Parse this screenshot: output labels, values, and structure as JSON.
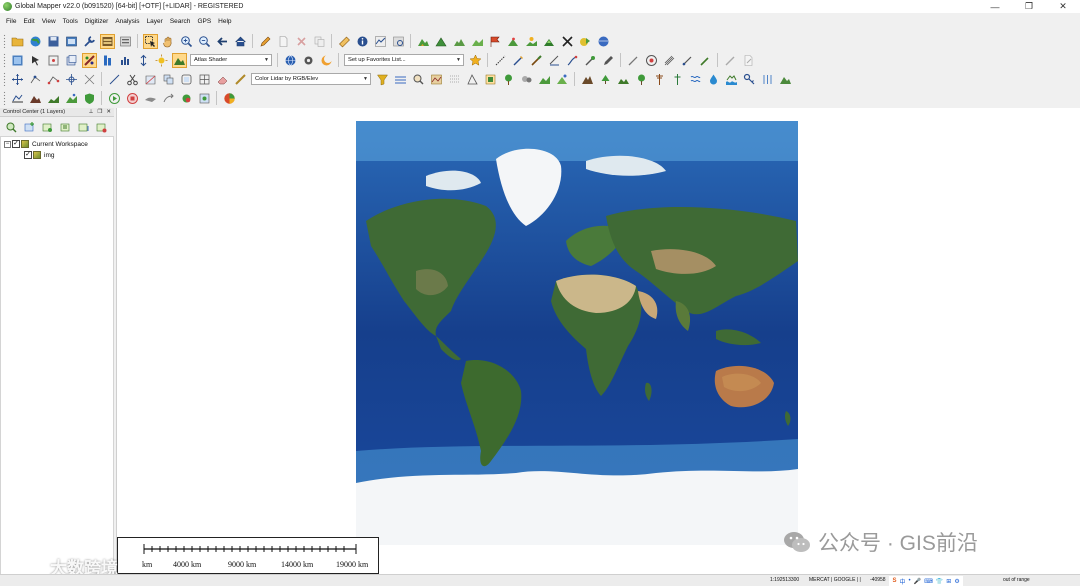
{
  "window": {
    "title": "Global Mapper v22.0 (b091520) [64-bit] [+OTF] [+LIDAR] - REGISTERED",
    "controls": {
      "minimize": "—",
      "restore": "❐",
      "close": "✕"
    }
  },
  "menu": {
    "items": [
      "File",
      "Edit",
      "View",
      "Tools",
      "Digitizer",
      "Analysis",
      "Layer",
      "Search",
      "GPS",
      "Help"
    ]
  },
  "toolbar": {
    "shader_select": "Atlas Shader",
    "favorites_select": "Set up Favorites List...",
    "lidar_color_select": "Color Lidar by RGB/Elev"
  },
  "control_center": {
    "title": "Control Center (1 Layers)",
    "header_controls": {
      "pin": "⊥",
      "restore": "❐",
      "close": "✕"
    },
    "workspace": "Current Workspace",
    "layers": [
      {
        "name": "img",
        "checked": true
      }
    ],
    "expand_symbol": "−",
    "check_symbol": "✓"
  },
  "map": {
    "scale_labels": [
      "km",
      "4000 km",
      "9000 km",
      "14000 km",
      "19000 km"
    ]
  },
  "statusbar": {
    "scale": "1:192513300",
    "projection": "MERCAT | GOOGLE | |",
    "coords": "-40958",
    "range": "out of range",
    "tray": [
      "S",
      "中",
      "•",
      "🎤",
      "⌨",
      "👕",
      "⊞",
      "⚙"
    ]
  },
  "watermarks": {
    "left": "大数跨境",
    "right": "公众号 · GIS前沿"
  },
  "colors": {
    "ocean_deep": "#123f8f",
    "ocean_shallow": "#3f8fd0",
    "land": "#3f6a35",
    "desert": "#cbb78a",
    "ice": "#f4f6f8",
    "highlight": "#ffd98a"
  }
}
